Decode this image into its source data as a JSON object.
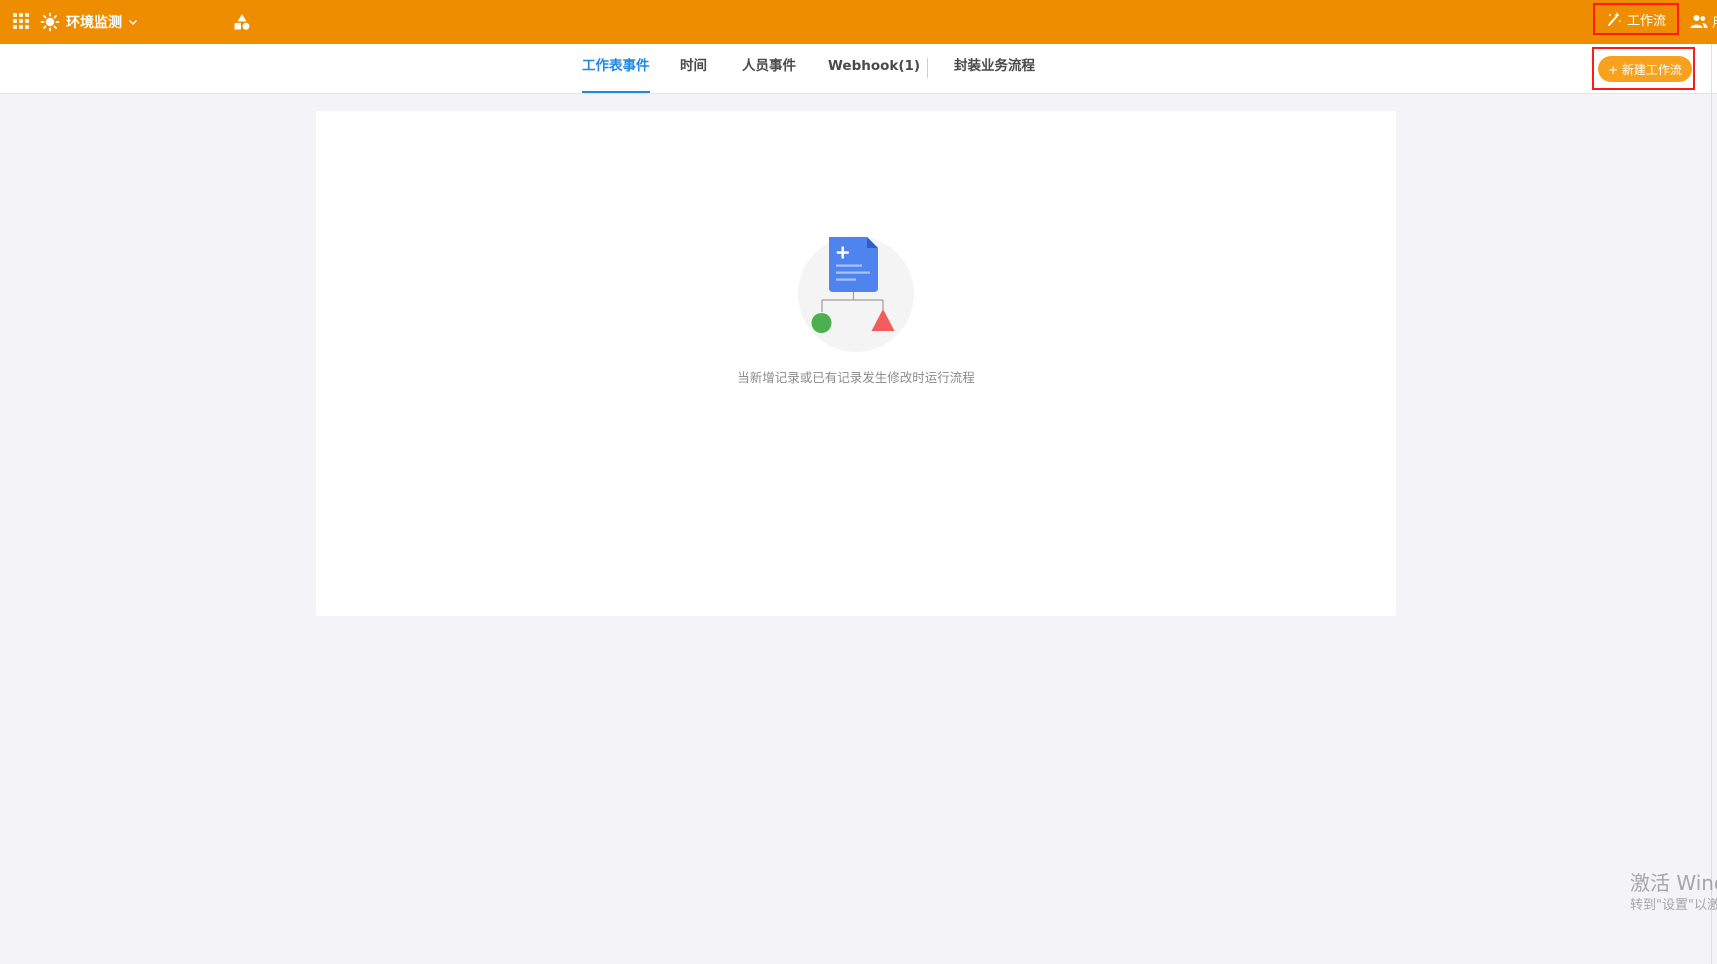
{
  "header": {
    "app_name": "环境监测",
    "workflow_tab": "工作流",
    "users_label": "用户",
    "colors": {
      "bar": "#ee8d00",
      "highlight": "#ff1a1a"
    },
    "icons": [
      "apps-grid-icon",
      "sun-icon",
      "chevron-down-icon",
      "shapes-icon",
      "magic-wand-icon",
      "users-icon"
    ]
  },
  "tabs": [
    {
      "label": "工作表事件",
      "active": true
    },
    {
      "label": "时间",
      "active": false
    },
    {
      "label": "人员事件",
      "active": false
    },
    {
      "label": "Webhook(1)",
      "active": false
    },
    {
      "label": "封装业务流程",
      "active": false
    }
  ],
  "actions": {
    "new_workflow": "+ 新建工作流"
  },
  "empty_state": {
    "hint": "当新增记录或已有记录发生修改时运行流程",
    "icon": "document-add-flow-icon"
  },
  "watermark": {
    "title": "激活 Windows",
    "subtitle": "转到\"设置\"以激活 Windows。"
  }
}
